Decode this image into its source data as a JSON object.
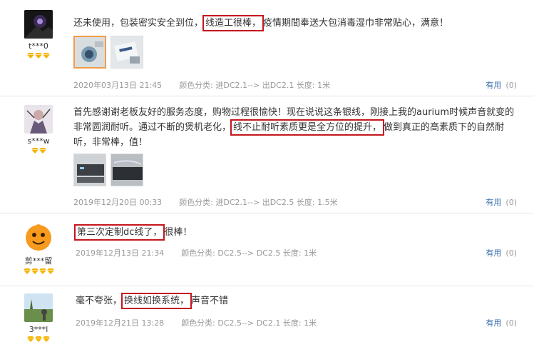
{
  "reviews": [
    {
      "nickname": "t***0",
      "star_count": 3,
      "text_parts": [
        {
          "t": "还未使用，包装密实安全到位，",
          "hl": false
        },
        {
          "t": "线造工很棒，",
          "hl": true
        },
        {
          "t": "疫情期間奉送大包消毒湿巾非常贴心，满意！",
          "hl": false
        }
      ],
      "date": "2020年03月13日 21:45",
      "spec_label": "颜色分类:",
      "spec_value": "进DC2.1--> 出DC2.1",
      "length_label": "长度:",
      "length_value": "1米",
      "useful_label": "有用",
      "useful_count": "(0)"
    },
    {
      "nickname": "s***w",
      "star_count": 2,
      "text_parts": [
        {
          "t": "首先感谢谢老板友好的服务态度，购物过程很愉快！现在说说这条银线，刚接上我的aurium时候声音就变的非常圆润耐听。通过不断的煲机老化，",
          "hl": false
        },
        {
          "t": "线不止耐听素质更是全方位的提升，",
          "hl": true
        },
        {
          "t": "做到真正的高素质下的自然耐听，非常棒，值！",
          "hl": false
        }
      ],
      "date": "2019年12月20日 00:33",
      "spec_label": "颜色分类:",
      "spec_value": "进DC2.1--> 出DC2.5",
      "length_label": "长度:",
      "length_value": "1.5米",
      "useful_label": "有用",
      "useful_count": "(0)"
    },
    {
      "nickname": "剪***留",
      "star_count": 4,
      "text_parts": [
        {
          "t": "第三次定制dc线了，",
          "hl": true
        },
        {
          "t": "很棒！",
          "hl": false
        }
      ],
      "date": "2019年12月13日 21:34",
      "spec_label": "颜色分类:",
      "spec_value": "DC2.5--> DC2.5",
      "length_label": "长度:",
      "length_value": "1米",
      "useful_label": "有用",
      "useful_count": "(0)"
    },
    {
      "nickname": "3***l",
      "star_count": 3,
      "text_parts": [
        {
          "t": "毫不夸张，",
          "hl": false
        },
        {
          "t": "换线如换系统，",
          "hl": true
        },
        {
          "t": "声音不错",
          "hl": false
        }
      ],
      "date": "2019年12月21日 13:28",
      "spec_label": "颜色分类:",
      "spec_value": "DC2.5--> DC2.1",
      "length_label": "长度:",
      "length_value": "1米",
      "useful_label": "有用",
      "useful_count": "(0)"
    }
  ],
  "colors": {
    "highlight_box": "#c4161c",
    "meta_text": "#999999",
    "useful_link": "#3a6fb0",
    "diamond": "#f5b400"
  }
}
